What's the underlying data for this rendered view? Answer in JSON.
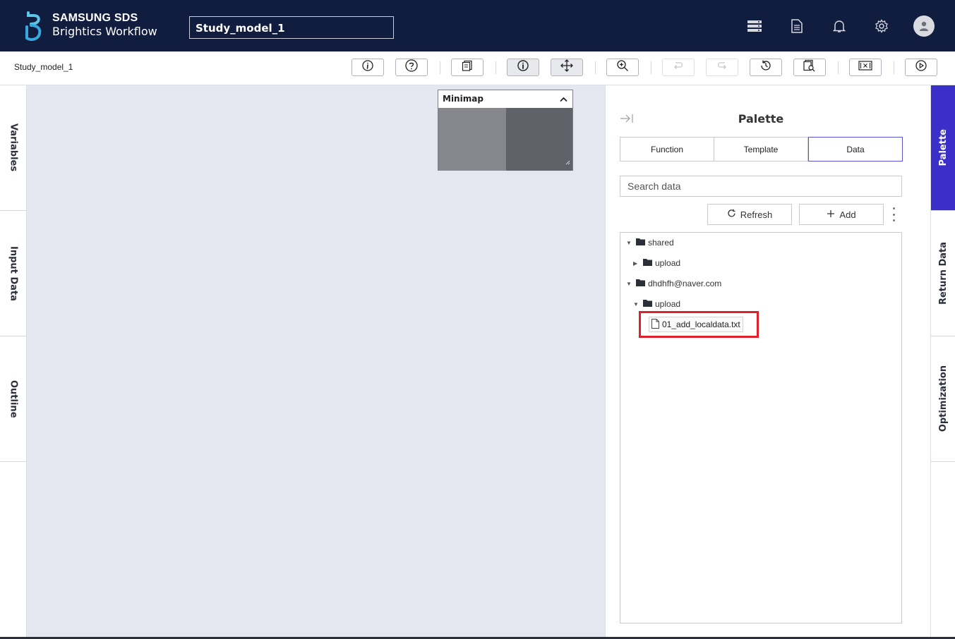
{
  "header": {
    "brand_line1": "SAMSUNG SDS",
    "brand_line2": "Brightics Workflow",
    "model_name": "Study_model_1",
    "icons": [
      "server-icon",
      "document-icon",
      "bell-icon",
      "gear-icon",
      "user-avatar-icon"
    ]
  },
  "toolbar": {
    "breadcrumb": "Study_model_1"
  },
  "left_tabs": [
    "Variables",
    "Input Data",
    "Outline"
  ],
  "canvas": {
    "minimap_title": "Minimap"
  },
  "palette": {
    "title": "Palette",
    "tabs": [
      "Function",
      "Template",
      "Data"
    ],
    "selected_tab": "Data",
    "search_placeholder": "Search data",
    "refresh_label": "Refresh",
    "add_label": "Add",
    "tree": {
      "shared": "shared",
      "shared_upload": "upload",
      "user": "dhdhfh@naver.com",
      "user_upload": "upload",
      "file": "01_add_localdata.txt"
    }
  },
  "right_tabs": [
    "Palette",
    "Return Data",
    "Optimization"
  ],
  "colors": {
    "header_bg": "#101d3f",
    "canvas_bg": "#e4e7ef",
    "accent": "#3a2fc8",
    "highlight": "#e0202a"
  }
}
